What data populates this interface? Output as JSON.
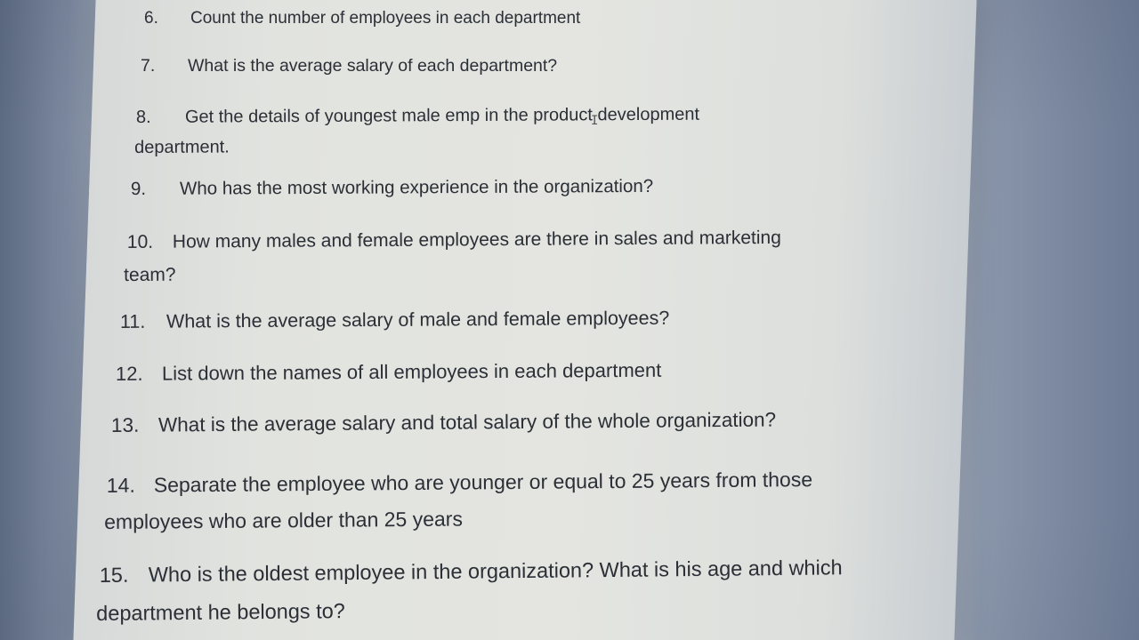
{
  "questions": [
    {
      "number": "6.",
      "text": "Count the number of employees in each department",
      "continuation": ""
    },
    {
      "number": "7.",
      "text": "What is the average salary of each department?",
      "continuation": ""
    },
    {
      "number": "8.",
      "text": "Get the details of youngest male emp in the product development",
      "continuation": "department."
    },
    {
      "number": "9.",
      "text": "Who has the most working experience in the organization?",
      "continuation": ""
    },
    {
      "number": "10.",
      "text": "How many males and female employees are there in sales and marketing",
      "continuation": "team?"
    },
    {
      "number": "11.",
      "text": "What is the average salary of male and female employees?",
      "continuation": ""
    },
    {
      "number": "12.",
      "text": "List down the names of all employees in each department",
      "continuation": ""
    },
    {
      "number": "13.",
      "text": "What is the average salary and total salary of the whole organization?",
      "continuation": ""
    },
    {
      "number": "14.",
      "text": "Separate the employee who are younger or equal to 25 years from those",
      "continuation": "employees who are older than 25 years"
    },
    {
      "number": "15.",
      "text": "Who is the oldest employee in the organization? What is his age and which",
      "continuation": "department he belongs to?"
    }
  ],
  "cursor_glyph": "I",
  "colors": {
    "text": "#2b2f36",
    "page": "#e2e4e0",
    "bezel": "#6d7b95"
  }
}
